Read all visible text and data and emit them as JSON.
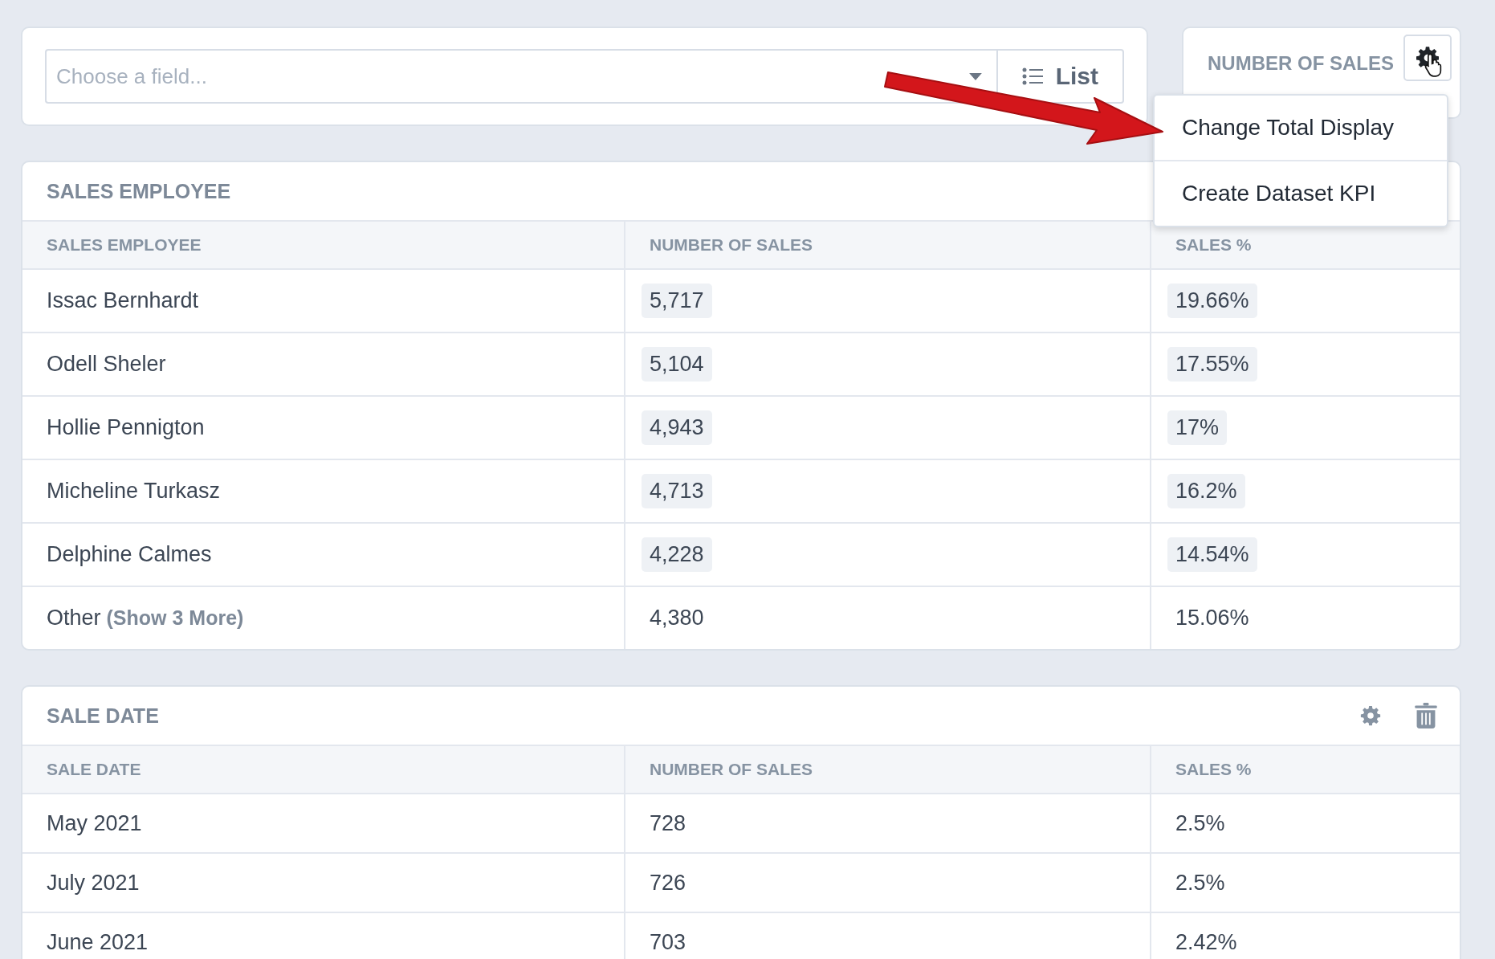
{
  "field_picker": {
    "placeholder": "Choose a field...",
    "view_button": "List"
  },
  "kpi": {
    "title": "NUMBER OF SALES",
    "menu": [
      {
        "label": "Change Total Display"
      },
      {
        "label": "Create Dataset KPI"
      }
    ]
  },
  "tables": [
    {
      "title": "SALES EMPLOYEE",
      "columns": [
        "SALES EMPLOYEE",
        "NUMBER OF SALES",
        "SALES %"
      ],
      "rows": [
        {
          "kind": "item",
          "name": "Issac Bernhardt",
          "count": "5,717",
          "share": "19.66%"
        },
        {
          "kind": "item",
          "name": "Odell Sheler",
          "count": "5,104",
          "share": "17.55%"
        },
        {
          "kind": "item",
          "name": "Hollie Pennigton",
          "count": "4,943",
          "share": "17%"
        },
        {
          "kind": "item",
          "name": "Micheline Turkasz",
          "count": "4,713",
          "share": "16.2%"
        },
        {
          "kind": "item",
          "name": "Delphine Calmes",
          "count": "4,228",
          "share": "14.54%"
        },
        {
          "kind": "other",
          "name": "Other",
          "more_link": "(Show 3 More)",
          "count": "4,380",
          "share": "15.06%"
        }
      ]
    },
    {
      "title": "SALE DATE",
      "show_actions": true,
      "columns": [
        "SALE DATE",
        "NUMBER OF SALES",
        "SALES %"
      ],
      "rows": [
        {
          "kind": "plain",
          "name": "May 2021",
          "count": "728",
          "share": "2.5%"
        },
        {
          "kind": "plain",
          "name": "July 2021",
          "count": "726",
          "share": "2.5%"
        },
        {
          "kind": "plain",
          "name": "June 2021",
          "count": "703",
          "share": "2.42%"
        }
      ]
    }
  ]
}
